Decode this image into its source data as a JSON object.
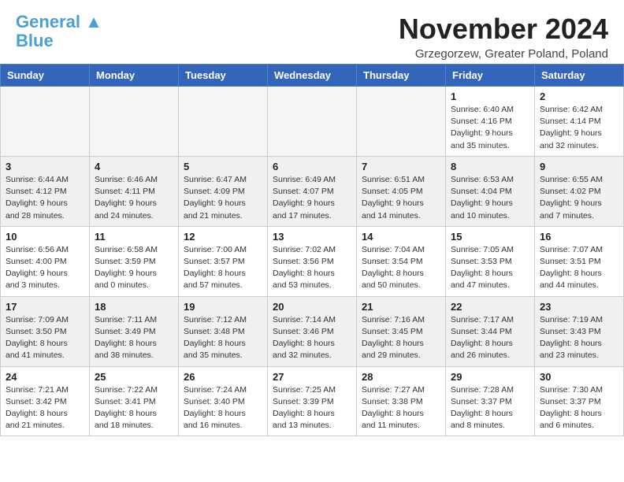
{
  "header": {
    "logo_line1": "General",
    "logo_line2": "Blue",
    "month_title": "November 2024",
    "location": "Grzegorzew, Greater Poland, Poland"
  },
  "weekdays": [
    "Sunday",
    "Monday",
    "Tuesday",
    "Wednesday",
    "Thursday",
    "Friday",
    "Saturday"
  ],
  "weeks": [
    [
      {
        "day": "",
        "info": ""
      },
      {
        "day": "",
        "info": ""
      },
      {
        "day": "",
        "info": ""
      },
      {
        "day": "",
        "info": ""
      },
      {
        "day": "",
        "info": ""
      },
      {
        "day": "1",
        "info": "Sunrise: 6:40 AM\nSunset: 4:16 PM\nDaylight: 9 hours\nand 35 minutes."
      },
      {
        "day": "2",
        "info": "Sunrise: 6:42 AM\nSunset: 4:14 PM\nDaylight: 9 hours\nand 32 minutes."
      }
    ],
    [
      {
        "day": "3",
        "info": "Sunrise: 6:44 AM\nSunset: 4:12 PM\nDaylight: 9 hours\nand 28 minutes."
      },
      {
        "day": "4",
        "info": "Sunrise: 6:46 AM\nSunset: 4:11 PM\nDaylight: 9 hours\nand 24 minutes."
      },
      {
        "day": "5",
        "info": "Sunrise: 6:47 AM\nSunset: 4:09 PM\nDaylight: 9 hours\nand 21 minutes."
      },
      {
        "day": "6",
        "info": "Sunrise: 6:49 AM\nSunset: 4:07 PM\nDaylight: 9 hours\nand 17 minutes."
      },
      {
        "day": "7",
        "info": "Sunrise: 6:51 AM\nSunset: 4:05 PM\nDaylight: 9 hours\nand 14 minutes."
      },
      {
        "day": "8",
        "info": "Sunrise: 6:53 AM\nSunset: 4:04 PM\nDaylight: 9 hours\nand 10 minutes."
      },
      {
        "day": "9",
        "info": "Sunrise: 6:55 AM\nSunset: 4:02 PM\nDaylight: 9 hours\nand 7 minutes."
      }
    ],
    [
      {
        "day": "10",
        "info": "Sunrise: 6:56 AM\nSunset: 4:00 PM\nDaylight: 9 hours\nand 3 minutes."
      },
      {
        "day": "11",
        "info": "Sunrise: 6:58 AM\nSunset: 3:59 PM\nDaylight: 9 hours\nand 0 minutes."
      },
      {
        "day": "12",
        "info": "Sunrise: 7:00 AM\nSunset: 3:57 PM\nDaylight: 8 hours\nand 57 minutes."
      },
      {
        "day": "13",
        "info": "Sunrise: 7:02 AM\nSunset: 3:56 PM\nDaylight: 8 hours\nand 53 minutes."
      },
      {
        "day": "14",
        "info": "Sunrise: 7:04 AM\nSunset: 3:54 PM\nDaylight: 8 hours\nand 50 minutes."
      },
      {
        "day": "15",
        "info": "Sunrise: 7:05 AM\nSunset: 3:53 PM\nDaylight: 8 hours\nand 47 minutes."
      },
      {
        "day": "16",
        "info": "Sunrise: 7:07 AM\nSunset: 3:51 PM\nDaylight: 8 hours\nand 44 minutes."
      }
    ],
    [
      {
        "day": "17",
        "info": "Sunrise: 7:09 AM\nSunset: 3:50 PM\nDaylight: 8 hours\nand 41 minutes."
      },
      {
        "day": "18",
        "info": "Sunrise: 7:11 AM\nSunset: 3:49 PM\nDaylight: 8 hours\nand 38 minutes."
      },
      {
        "day": "19",
        "info": "Sunrise: 7:12 AM\nSunset: 3:48 PM\nDaylight: 8 hours\nand 35 minutes."
      },
      {
        "day": "20",
        "info": "Sunrise: 7:14 AM\nSunset: 3:46 PM\nDaylight: 8 hours\nand 32 minutes."
      },
      {
        "day": "21",
        "info": "Sunrise: 7:16 AM\nSunset: 3:45 PM\nDaylight: 8 hours\nand 29 minutes."
      },
      {
        "day": "22",
        "info": "Sunrise: 7:17 AM\nSunset: 3:44 PM\nDaylight: 8 hours\nand 26 minutes."
      },
      {
        "day": "23",
        "info": "Sunrise: 7:19 AM\nSunset: 3:43 PM\nDaylight: 8 hours\nand 23 minutes."
      }
    ],
    [
      {
        "day": "24",
        "info": "Sunrise: 7:21 AM\nSunset: 3:42 PM\nDaylight: 8 hours\nand 21 minutes."
      },
      {
        "day": "25",
        "info": "Sunrise: 7:22 AM\nSunset: 3:41 PM\nDaylight: 8 hours\nand 18 minutes."
      },
      {
        "day": "26",
        "info": "Sunrise: 7:24 AM\nSunset: 3:40 PM\nDaylight: 8 hours\nand 16 minutes."
      },
      {
        "day": "27",
        "info": "Sunrise: 7:25 AM\nSunset: 3:39 PM\nDaylight: 8 hours\nand 13 minutes."
      },
      {
        "day": "28",
        "info": "Sunrise: 7:27 AM\nSunset: 3:38 PM\nDaylight: 8 hours\nand 11 minutes."
      },
      {
        "day": "29",
        "info": "Sunrise: 7:28 AM\nSunset: 3:37 PM\nDaylight: 8 hours\nand 8 minutes."
      },
      {
        "day": "30",
        "info": "Sunrise: 7:30 AM\nSunset: 3:37 PM\nDaylight: 8 hours\nand 6 minutes."
      }
    ]
  ]
}
